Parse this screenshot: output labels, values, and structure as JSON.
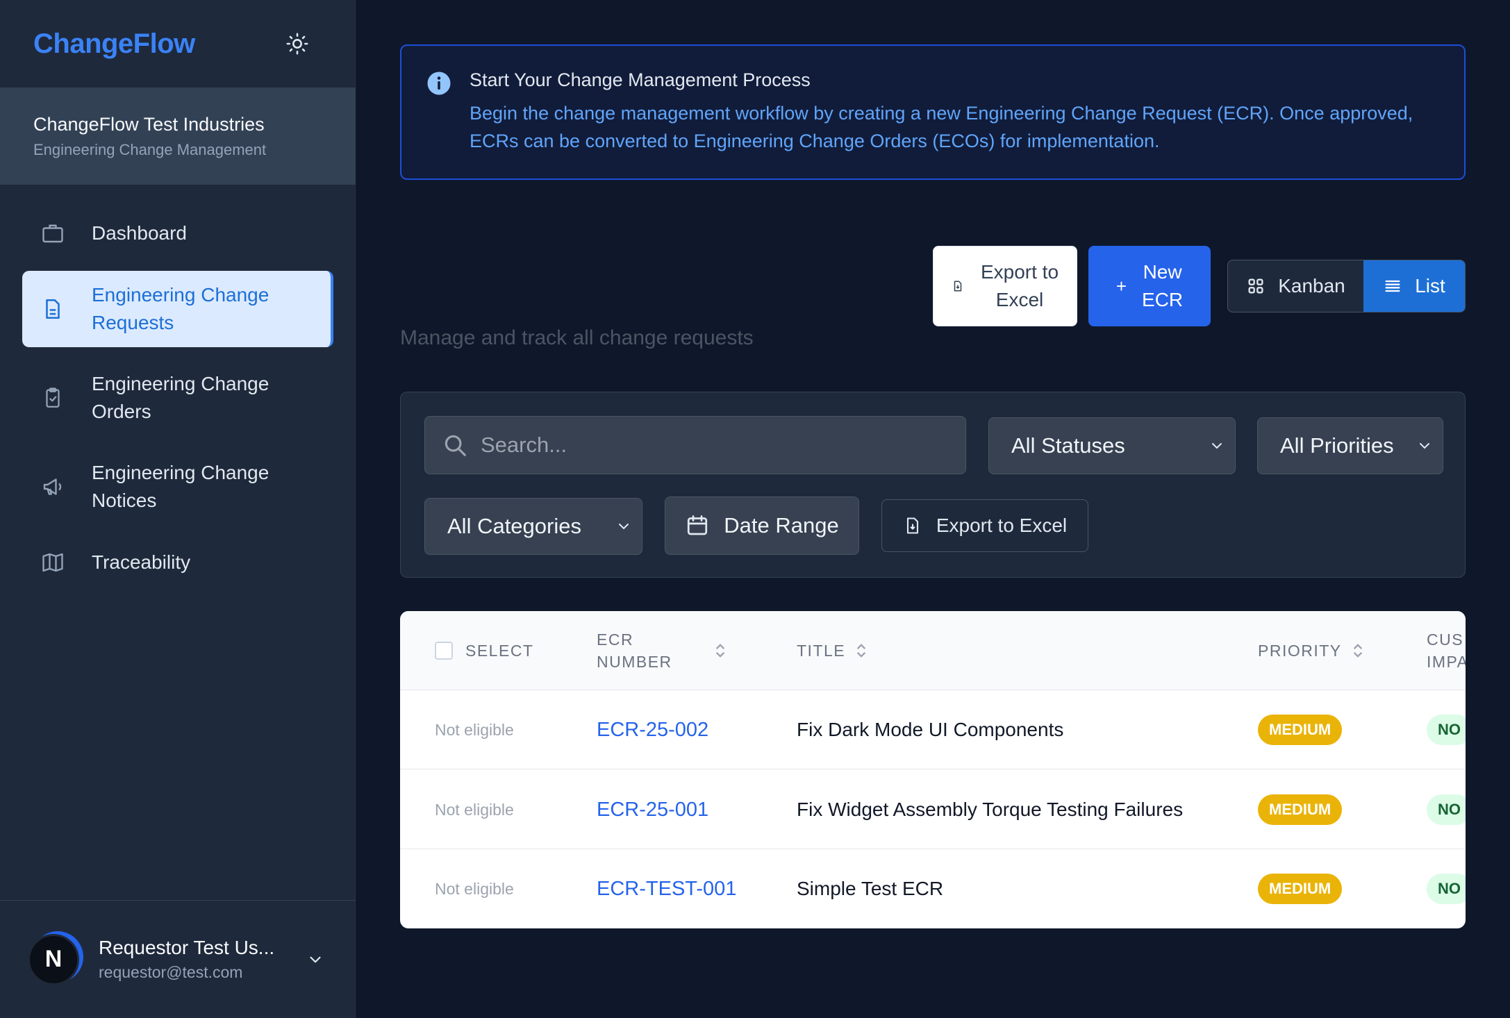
{
  "sidebar": {
    "brand": "ChangeFlow",
    "org_name": "ChangeFlow Test Industries",
    "org_subtitle": "Engineering Change Management",
    "items": [
      {
        "label": "Dashboard",
        "icon": "briefcase-icon"
      },
      {
        "label_line1": "Engineering Change",
        "label_line2": "Requests",
        "icon": "document-icon",
        "active": true
      },
      {
        "label_line1": "Engineering Change",
        "label_line2": "Orders",
        "icon": "clipboard-check-icon"
      },
      {
        "label_line1": "Engineering Change",
        "label_line2": "Notices",
        "icon": "megaphone-icon"
      },
      {
        "label": "Traceability",
        "icon": "map-icon"
      }
    ],
    "user": {
      "avatar_letter": "N",
      "name": "Requestor Test Us...",
      "email": "requestor@test.com"
    }
  },
  "banner": {
    "title": "Start Your Change Management Process",
    "body": "Begin the change management workflow by creating a new Engineering Change Request (ECR). Once approved, ECRs can be converted to Engineering Change Orders (ECOs) for implementation."
  },
  "toolbar": {
    "export_line1": "Export to",
    "export_line2": "Excel",
    "new_line1": "New",
    "new_line2": "ECR",
    "view_kanban": "Kanban",
    "view_list": "List",
    "active_view": "List"
  },
  "subtitle": "Manage and track all change requests",
  "filters": {
    "search_placeholder": "Search...",
    "status": "All Statuses",
    "priority": "All Priorities",
    "category": "All Categories",
    "date_range": "Date Range",
    "export": "Export to Excel"
  },
  "table": {
    "headers": {
      "select": "SELECT",
      "number_line1": "ECR",
      "number_line2": "NUMBER",
      "title": "TITLE",
      "priority": "PRIORITY",
      "impact_line1": "CUS",
      "impact_line2": "IMPA"
    },
    "rows": [
      {
        "eligibility": "Not eligible",
        "number": "ECR-25-002",
        "title": "Fix Dark Mode UI Components",
        "priority": "MEDIUM",
        "impact": "NO"
      },
      {
        "eligibility": "Not eligible",
        "number": "ECR-25-001",
        "title": "Fix Widget Assembly Torque Testing Failures",
        "priority": "MEDIUM",
        "impact": "NO"
      },
      {
        "eligibility": "Not eligible",
        "number": "ECR-TEST-001",
        "title": "Simple Test ECR",
        "priority": "MEDIUM",
        "impact": "NO"
      }
    ]
  },
  "colors": {
    "accent": "#3b82f6",
    "sidebar_bg": "#1e293b",
    "page_bg": "#0f172a",
    "priority_medium": "#eab308"
  }
}
